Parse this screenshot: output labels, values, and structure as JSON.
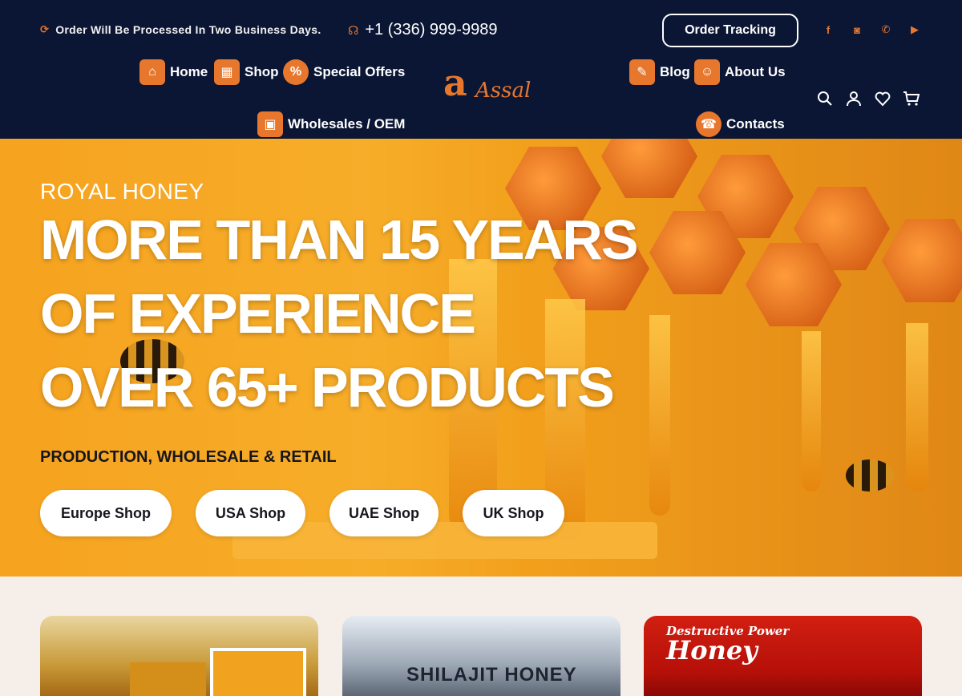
{
  "header": {
    "notice": "Order Will Be Processed In Two Business Days.",
    "phone": "+1 (336) 999-9989",
    "order_tracking": "Order Tracking",
    "socials": [
      "facebook-icon",
      "instagram-icon",
      "whatsapp-icon",
      "youtube-icon"
    ],
    "nav": {
      "home": "Home",
      "shop": "Shop",
      "special_offers": "Special Offers",
      "wholesales": "Wholesales / OEM",
      "blog": "Blog",
      "about": "About Us",
      "contacts": "Contacts"
    },
    "logo": {
      "mark": "a",
      "text": "Assal"
    },
    "icons": [
      "search-icon",
      "account-icon",
      "wishlist-icon",
      "cart-icon"
    ]
  },
  "hero": {
    "tagline": "ROYAL HONEY",
    "line1": "MORE THAN 15 YEARS",
    "line2": "OF EXPERIENCE",
    "line3": "OVER 65+ PRODUCTS",
    "subtitle": "PRODUCTION, WHOLESALE & RETAIL",
    "buttons": [
      "Europe Shop",
      "USA Shop",
      "UAE Shop",
      "UK Shop"
    ]
  },
  "cards": {
    "card2_title": "SHILAJIT HONEY",
    "card3_line1": "Destructive Power",
    "card3_line2": "Honey"
  },
  "colors": {
    "header_bg": "#0a1634",
    "accent": "#e8772e",
    "hero_bg": "#f6a31f"
  }
}
